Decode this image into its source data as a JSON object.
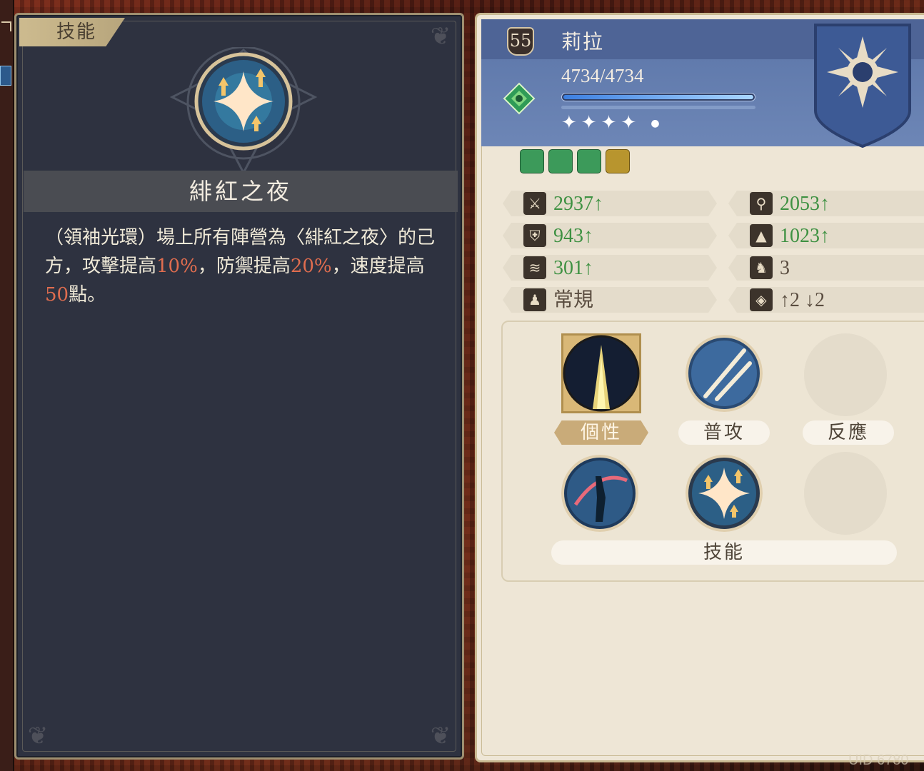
{
  "skill_panel": {
    "tab_label": "技能",
    "skill_name": "緋紅之夜",
    "desc_parts": {
      "p1": "（領袖光環）場上所有陣營為〈緋紅之夜〉的己方，攻擊提高",
      "v1": "10%",
      "p2": "，防禦提高",
      "v2": "20%",
      "p3": "，速度提高",
      "v3": "50",
      "p4": "點。"
    },
    "highlight_color": "#e06d4f"
  },
  "character": {
    "level": "55",
    "name": "莉拉",
    "hp": "4734/4734",
    "hp_fraction": 1.0,
    "stars": "✦✦✦✦",
    "element_icon": "element-gem-icon",
    "crest_icon": "sun-crest-icon"
  },
  "traits": [
    "trait-crowd-icon",
    "trait-fist-icon",
    "trait-sword-up-icon",
    "trait-cross-swords-icon"
  ],
  "stats": {
    "attack": {
      "icon": "sword-icon",
      "value": "2937",
      "arrow": "↑"
    },
    "magic_attack": {
      "icon": "staff-icon",
      "value": "2053",
      "arrow": "↑"
    },
    "defense": {
      "icon": "shield-icon",
      "value": "943",
      "arrow": "↑"
    },
    "magic_defense": {
      "icon": "wizard-hat-icon",
      "value": "1023",
      "arrow": "↑"
    },
    "speed": {
      "icon": "wing-icon",
      "value": "301",
      "arrow": "↑"
    },
    "movement": {
      "icon": "boot-icon",
      "value": "3"
    },
    "type": {
      "icon": "pawn-icon",
      "value": "常規"
    },
    "range": {
      "icon": "range-icon",
      "value": "↑2 ↓2"
    }
  },
  "skills": {
    "personality_label": "個性",
    "normal_attack_label": "普攻",
    "reaction_label": "反應",
    "skill_label": "技能"
  },
  "uid_label": "UID 6780"
}
